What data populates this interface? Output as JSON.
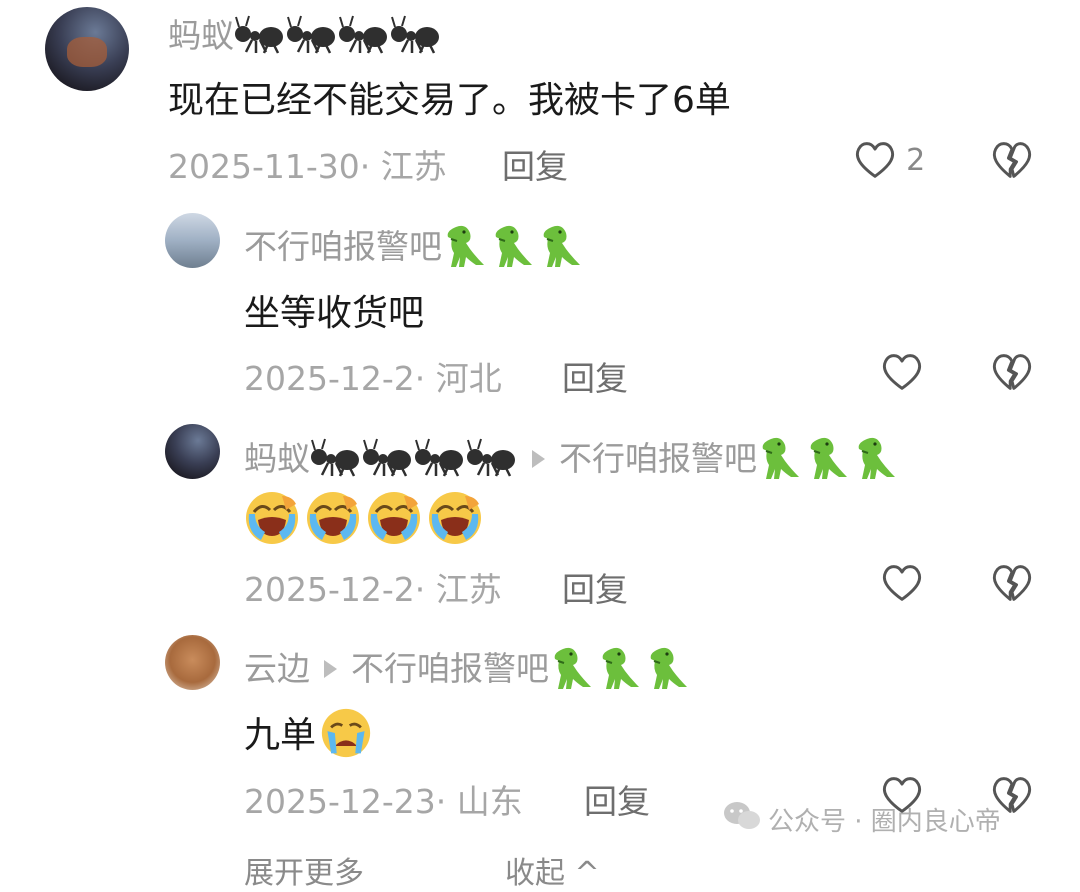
{
  "comments": [
    {
      "author": "蚂蚁",
      "author_badges": [
        "ant",
        "ant",
        "ant",
        "ant"
      ],
      "text": "现在已经不能交易了。我被卡了6单",
      "date": "2025-11-30",
      "location": "江苏",
      "reply_label": "回复",
      "like_count": "2"
    },
    {
      "author": "不行咱报警吧",
      "author_badges": [
        "dinosaur",
        "dinosaur",
        "dinosaur"
      ],
      "text": "坐等收货吧",
      "date": "2025-12-2",
      "location": "河北",
      "reply_label": "回复"
    },
    {
      "author": "蚂蚁",
      "author_badges": [
        "ant",
        "ant",
        "ant",
        "ant"
      ],
      "reply_to": "不行咱报警吧",
      "reply_to_badges": [
        "dinosaur",
        "dinosaur",
        "dinosaur"
      ],
      "text_emojis": [
        "crying-face",
        "crying-face",
        "crying-face",
        "crying-face"
      ],
      "date": "2025-12-2",
      "location": "江苏",
      "reply_label": "回复"
    },
    {
      "author": "云边",
      "reply_to": "不行咱报警吧",
      "reply_to_badges": [
        "dinosaur",
        "dinosaur",
        "dinosaur"
      ],
      "text": "九单",
      "text_emojis": [
        "sad-crying-face"
      ],
      "date": "2025-12-23",
      "location": "山东",
      "reply_label": "回复"
    }
  ],
  "footer": {
    "expand_label": "展开更多",
    "collapse_label": "收起"
  },
  "watermark": {
    "text": "公众号 · 圈内良心帝"
  },
  "colors": {
    "name": "#9b9b9b",
    "meta": "#a6a6a6",
    "text": "#1a1a1a",
    "dino": "#6cbf3c",
    "ant": "#3a3a3a",
    "emoji": "#f7c948"
  }
}
